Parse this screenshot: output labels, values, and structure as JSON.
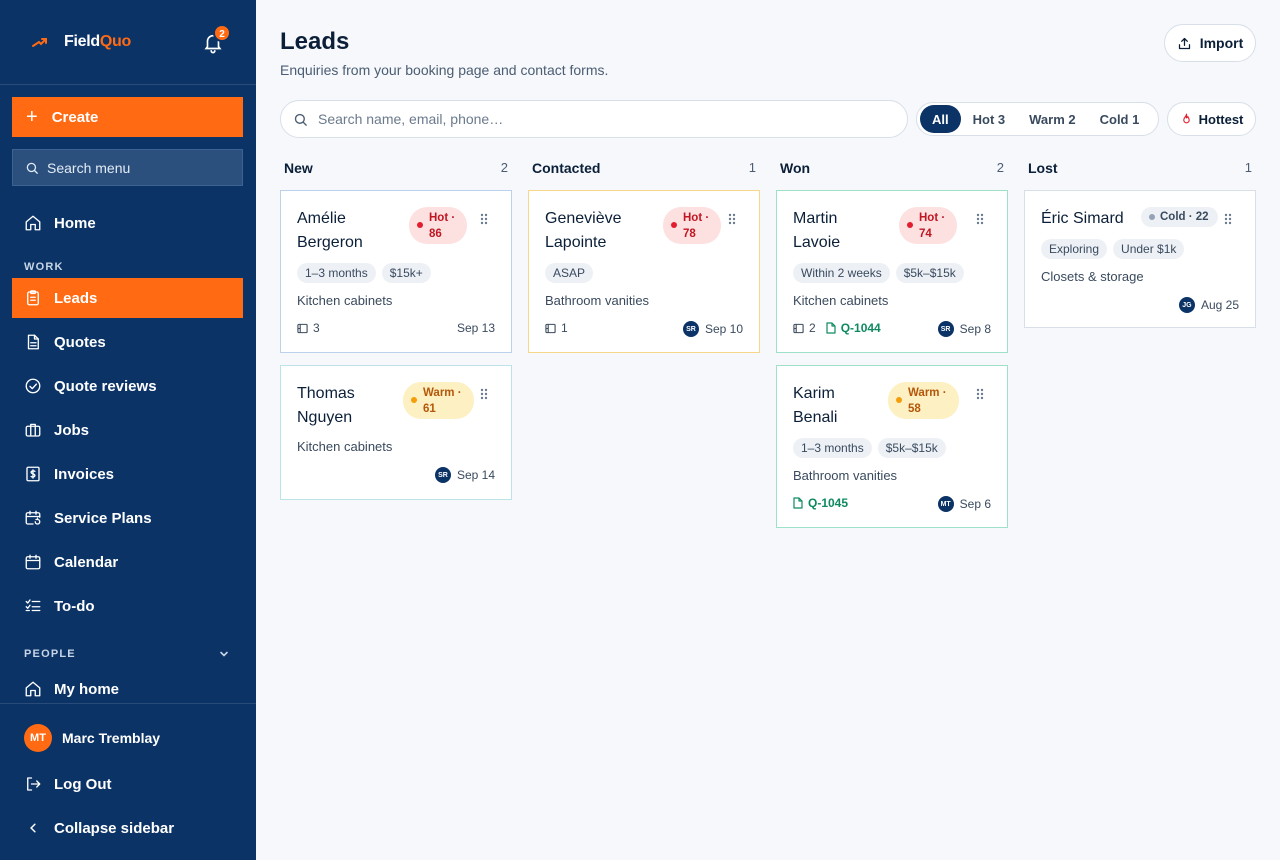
{
  "brand": {
    "name_prefix": "Field",
    "name_accent": "Quo",
    "notification_count": "2",
    "accent_color": "#ff6a13",
    "sidebar_color": "#0b3366"
  },
  "sidebar": {
    "create_label": "Create",
    "search_label": "Search menu",
    "home_label": "Home",
    "work_section": "WORK",
    "work_items": [
      {
        "label": "Leads",
        "icon": "clipboard-icon",
        "active": true
      },
      {
        "label": "Quotes",
        "icon": "document-icon"
      },
      {
        "label": "Quote reviews",
        "icon": "check-circle-icon"
      },
      {
        "label": "Jobs",
        "icon": "briefcase-icon"
      },
      {
        "label": "Invoices",
        "icon": "invoice-icon"
      },
      {
        "label": "Service Plans",
        "icon": "calendar-repeat-icon"
      },
      {
        "label": "Calendar",
        "icon": "calendar-icon"
      },
      {
        "label": "To-do",
        "icon": "checklist-icon"
      }
    ],
    "people_section": "PEOPLE",
    "my_home_label": "My home",
    "user": {
      "initials": "MT",
      "name": "Marc Tremblay"
    },
    "logout_label": "Log Out",
    "collapse_label": "Collapse sidebar"
  },
  "header": {
    "title": "Leads",
    "subtitle": "Enquiries from your booking page and contact forms.",
    "import_label": "Import"
  },
  "toolbar": {
    "search_placeholder": "Search name, email, phone…",
    "filters": [
      {
        "label": "All",
        "active": true
      },
      {
        "label": "Hot 3"
      },
      {
        "label": "Warm 2"
      },
      {
        "label": "Cold 1"
      }
    ],
    "sort_label": "Hottest"
  },
  "columns": [
    {
      "name": "New",
      "count": "2",
      "cards": [
        {
          "name_line1": "Amélie",
          "name_line2": "Bergeron",
          "score_label": "Hot ·",
          "score_value": "86",
          "temperature": "hot",
          "tags": [
            "1–3 months",
            "$15k+"
          ],
          "service": "Kitchen cabinets",
          "photos": "3",
          "date": "Sep 13"
        },
        {
          "name_line1": "Thomas",
          "name_line2": "Nguyen",
          "score_label": "Warm ·",
          "score_value": "61",
          "temperature": "warm",
          "tags": [],
          "service": "Kitchen cabinets",
          "assignee": "SR",
          "date": "Sep 14"
        }
      ]
    },
    {
      "name": "Contacted",
      "count": "1",
      "cards": [
        {
          "name_line1": "Geneviève",
          "name_line2": "Lapointe",
          "score_label": "Hot ·",
          "score_value": "78",
          "temperature": "hot",
          "tags": [
            "ASAP"
          ],
          "service": "Bathroom vanities",
          "photos": "1",
          "assignee": "SR",
          "date": "Sep 10"
        }
      ]
    },
    {
      "name": "Won",
      "count": "2",
      "cards": [
        {
          "name_line1": "Martin",
          "name_line2": "Lavoie",
          "score_label": "Hot ·",
          "score_value": "74",
          "temperature": "hot",
          "tags": [
            "Within 2 weeks",
            "$5k–$15k"
          ],
          "service": "Kitchen cabinets",
          "photos": "2",
          "quote": "Q-1044",
          "assignee": "SR",
          "date": "Sep 8"
        },
        {
          "name_line1": "Karim",
          "name_line2": "Benali",
          "score_label": "Warm ·",
          "score_value": "58",
          "temperature": "warm",
          "tags": [
            "1–3 months",
            "$5k–$15k"
          ],
          "service": "Bathroom vanities",
          "quote": "Q-1045",
          "assignee": "MT",
          "date": "Sep 6"
        }
      ]
    },
    {
      "name": "Lost",
      "count": "1",
      "cards": [
        {
          "name": "Éric Simard",
          "score_text": "Cold · 22",
          "temperature": "cold",
          "tags": [
            "Exploring",
            "Under $1k"
          ],
          "service": "Closets & storage",
          "assignee": "JG",
          "date": "Aug 25"
        }
      ]
    }
  ]
}
